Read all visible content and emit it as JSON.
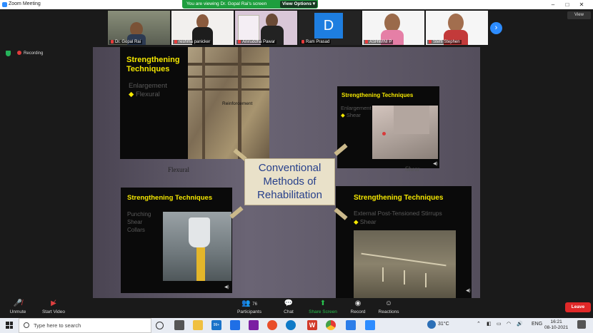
{
  "app": {
    "title": "Zoom Meeting"
  },
  "banner": {
    "text": "You are viewing Dr. Gopal Rai's screen",
    "view_options": "View Options ▾"
  },
  "participants": [
    {
      "name": "Dr. Gopal Rai",
      "tile": "photo-man"
    },
    {
      "name": "reshma panicker",
      "tile": "photo-woman"
    },
    {
      "name": "Aniruddha Pawar",
      "tile": "photo-man2"
    },
    {
      "name": "Ram Prasad",
      "initial": "D",
      "tile": "initial"
    },
    {
      "name": "ASHWINI P",
      "tile": "photo-woman2"
    },
    {
      "name": "Steffi Stephen",
      "tile": "photo-woman3"
    }
  ],
  "speaker_view": "View",
  "recording": "Recording",
  "slide": {
    "tl": {
      "title": "Strengthening\nTechniques",
      "item1": "Enlargement",
      "item2": "Flexural",
      "photo_caption": "Reinforcement"
    },
    "tr": {
      "title": "Strengthening Techniques",
      "item1": "Enlargement",
      "item2": "Shear"
    },
    "bl": {
      "title": "Strengthening Techniques",
      "item1": "Punching",
      "item2": "Shear",
      "item3": "Collars"
    },
    "br": {
      "title": "Strengthening Techniques",
      "item1": "External Post-Tensioned Stirrups",
      "item2": "Shear"
    },
    "center": {
      "line1": "Conventional",
      "line2": "Methods of",
      "line3": "Rehabilitation"
    },
    "flexural_label": "Flexural",
    "shear_label": "Shear"
  },
  "toolbar": {
    "unmute": "Unmute",
    "start_video": "Start Video",
    "participants": "Participants",
    "participant_count": "76",
    "chat": "Chat",
    "share_screen": "Share Screen",
    "record": "Record",
    "reactions": "Reactions",
    "leave": "Leave"
  },
  "taskbar": {
    "search_placeholder": "Type here to search",
    "weather": "31°C",
    "lang": "ENG",
    "time": "16:21",
    "date": "08-10-2021",
    "notifications": "99+"
  },
  "colors": {
    "accent": "#2d8cff",
    "share_green": "#28c24d",
    "leave_red": "#e02828",
    "slide_yellow": "#f5e800"
  }
}
